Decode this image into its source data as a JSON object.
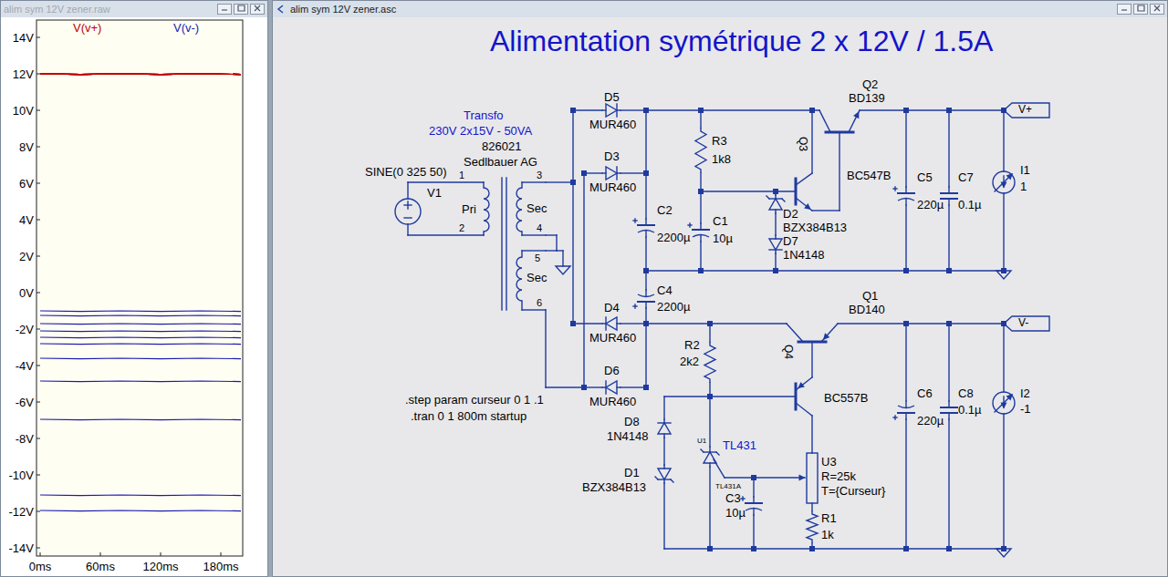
{
  "waveform_window": {
    "title": "alim sym 12V zener.raw",
    "active": false
  },
  "chart": {
    "y_ticks": [
      "14V",
      "12V",
      "10V",
      "8V",
      "6V",
      "4V",
      "2V",
      "0V",
      "-2V",
      "-4V",
      "-6V",
      "-8V",
      "-10V",
      "-12V",
      "-14V"
    ],
    "x_ticks": [
      "0ms",
      "60ms",
      "120ms",
      "180ms"
    ],
    "series": [
      {
        "name": "V(v+)",
        "color": "#c00000",
        "traces": [
          [
            12,
            11.97,
            12,
            11.97,
            12,
            11.97
          ],
          [
            12,
            11.97,
            12,
            11.97,
            12,
            11.97
          ],
          [
            12,
            11.97,
            12,
            11.97,
            12,
            11.97
          ],
          [
            12,
            11.97,
            12,
            11.97,
            12,
            11.97
          ],
          [
            12,
            11.97,
            12,
            11.97,
            12,
            11.97
          ],
          [
            12,
            11.97,
            12,
            11.97,
            12,
            11.97
          ],
          [
            12,
            11.97,
            12,
            11.97,
            12,
            11.97
          ],
          [
            12,
            11.97,
            12,
            11.97,
            12,
            11.97
          ],
          [
            12,
            11.97,
            12,
            11.97,
            12,
            11.97
          ],
          [
            12,
            11.97,
            12,
            11.97,
            12,
            11.97
          ],
          [
            12,
            11.97,
            12,
            11.97,
            12,
            11.97
          ]
        ]
      },
      {
        "name": "V(v-)",
        "color": "#1a1ab0",
        "traces": [
          [
            -1.0,
            -1.03,
            -1.0,
            -1.03,
            -1.0,
            -1.03
          ],
          [
            -1.25,
            -1.28,
            -1.25,
            -1.28,
            -1.25,
            -1.28
          ],
          [
            -1.7,
            -1.73,
            -1.7,
            -1.73,
            -1.7,
            -1.73
          ],
          [
            -2.1,
            -2.13,
            -2.1,
            -2.13,
            -2.1,
            -2.13
          ],
          [
            -2.45,
            -2.48,
            -2.45,
            -2.48,
            -2.45,
            -2.48
          ],
          [
            -2.8,
            -2.83,
            -2.8,
            -2.83,
            -2.8,
            -2.83
          ],
          [
            -3.6,
            -3.63,
            -3.6,
            -3.63,
            -3.6,
            -3.63
          ],
          [
            -4.85,
            -4.88,
            -4.85,
            -4.88,
            -4.85,
            -4.88
          ],
          [
            -6.95,
            -6.98,
            -6.95,
            -6.98,
            -6.95,
            -6.98
          ],
          [
            -11.1,
            -11.13,
            -11.1,
            -11.13,
            -11.1,
            -11.13
          ],
          [
            -11.95,
            -11.98,
            -11.95,
            -11.98,
            -11.95,
            -11.98
          ]
        ]
      }
    ]
  },
  "schematic_window": {
    "title": "alim sym 12V zener.asc",
    "active": true
  },
  "schematic": {
    "title": "Alimentation symétrique 2 x 12V / 1.5A",
    "labels": [
      {
        "text": "Transfo",
        "kind": "comment"
      },
      {
        "text": "230V 2x15V - 50VA",
        "kind": "comment"
      },
      {
        "text": "826021",
        "kind": "attr"
      },
      {
        "text": "Sedlbauer AG",
        "kind": "attr"
      },
      {
        "text": "SINE(0 325 50)",
        "kind": "attr"
      },
      {
        "text": "V1",
        "kind": "attr"
      },
      {
        "text": "1",
        "kind": "pin"
      },
      {
        "text": "Pri",
        "kind": "attr"
      },
      {
        "text": "2",
        "kind": "pin"
      },
      {
        "text": "3",
        "kind": "pin"
      },
      {
        "text": "Sec",
        "kind": "attr"
      },
      {
        "text": "4",
        "kind": "pin"
      },
      {
        "text": "5",
        "kind": "pin"
      },
      {
        "text": "Sec",
        "kind": "attr"
      },
      {
        "text": "6",
        "kind": "pin"
      },
      {
        "text": "D5",
        "kind": "attr"
      },
      {
        "text": "MUR460",
        "kind": "attr"
      },
      {
        "text": "D3",
        "kind": "attr"
      },
      {
        "text": "MUR460",
        "kind": "attr"
      },
      {
        "text": "C2",
        "kind": "attr"
      },
      {
        "text": "2200µ",
        "kind": "attr"
      },
      {
        "text": "C1",
        "kind": "attr"
      },
      {
        "text": "10µ",
        "kind": "attr"
      },
      {
        "text": "C4",
        "kind": "attr"
      },
      {
        "text": "2200µ",
        "kind": "attr"
      },
      {
        "text": "D4",
        "kind": "attr"
      },
      {
        "text": "MUR460",
        "kind": "attr"
      },
      {
        "text": "D6",
        "kind": "attr"
      },
      {
        "text": "MUR460",
        "kind": "attr"
      },
      {
        "text": "R3",
        "kind": "attr"
      },
      {
        "text": "1k8",
        "kind": "attr"
      },
      {
        "text": "Q2",
        "kind": "attr"
      },
      {
        "text": "BD139",
        "kind": "attr"
      },
      {
        "text": "Q3",
        "kind": "vertical"
      },
      {
        "text": "BC547B",
        "kind": "attr"
      },
      {
        "text": "D2",
        "kind": "attr"
      },
      {
        "text": "BZX384B13",
        "kind": "attr"
      },
      {
        "text": "D7",
        "kind": "attr"
      },
      {
        "text": "1N4148",
        "kind": "attr"
      },
      {
        "text": "C5",
        "kind": "attr"
      },
      {
        "text": "220µ",
        "kind": "attr"
      },
      {
        "text": "C7",
        "kind": "attr"
      },
      {
        "text": "0.1µ",
        "kind": "attr"
      },
      {
        "text": "I1",
        "kind": "attr"
      },
      {
        "text": "1",
        "kind": "attr"
      },
      {
        "text": "V+",
        "kind": "port"
      },
      {
        "text": "Q1",
        "kind": "attr"
      },
      {
        "text": "BD140",
        "kind": "attr"
      },
      {
        "text": "Q4",
        "kind": "vertical"
      },
      {
        "text": "BC557B",
        "kind": "attr"
      },
      {
        "text": "R2",
        "kind": "attr"
      },
      {
        "text": "2k2",
        "kind": "attr"
      },
      {
        "text": "D8",
        "kind": "attr"
      },
      {
        "text": "1N4148",
        "kind": "attr"
      },
      {
        "text": "D1",
        "kind": "attr"
      },
      {
        "text": "BZX384B13",
        "kind": "attr"
      },
      {
        "text": "U1",
        "kind": "tiny"
      },
      {
        "text": "TL431",
        "kind": "comment"
      },
      {
        "text": "TL431A",
        "kind": "tiny"
      },
      {
        "text": "U3",
        "kind": "attr"
      },
      {
        "text": "R=25k",
        "kind": "attr"
      },
      {
        "text": "T={Curseur}",
        "kind": "attr"
      },
      {
        "text": "C3",
        "kind": "attr"
      },
      {
        "text": "10µ",
        "kind": "attr"
      },
      {
        "text": "R1",
        "kind": "attr"
      },
      {
        "text": "1k",
        "kind": "attr"
      },
      {
        "text": "C6",
        "kind": "attr"
      },
      {
        "text": "220µ",
        "kind": "attr"
      },
      {
        "text": "C8",
        "kind": "attr"
      },
      {
        "text": "0.1µ",
        "kind": "attr"
      },
      {
        "text": "I2",
        "kind": "attr"
      },
      {
        "text": "-1",
        "kind": "attr"
      },
      {
        "text": "V-",
        "kind": "port"
      },
      {
        "text": ".step param curseur 0 1 .1",
        "kind": "directive"
      },
      {
        "text": ".tran 0 1 800m startup",
        "kind": "directive"
      }
    ]
  }
}
